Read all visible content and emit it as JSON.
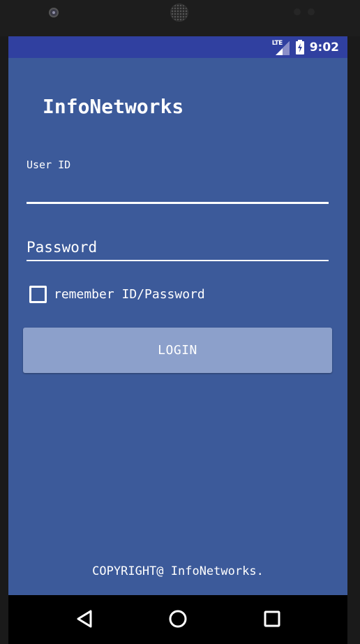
{
  "status_bar": {
    "network_label": "LTE",
    "time": "9:02",
    "background": "#3040a0"
  },
  "app": {
    "title": "InfoNetworks",
    "background": "#3c5a9a"
  },
  "form": {
    "user_id_label": "User ID",
    "user_id_value": "",
    "password_placeholder": "Password",
    "password_value": "",
    "remember_label": "remember ID/Password",
    "remember_checked": false,
    "login_label": "LOGIN",
    "login_button_color": "#8ca0cb"
  },
  "footer": {
    "copyright": "COPYRIGHT@ InfoNetworks."
  },
  "navigation": {
    "back": "back-icon",
    "home": "home-icon",
    "recent": "recent-apps-icon"
  }
}
